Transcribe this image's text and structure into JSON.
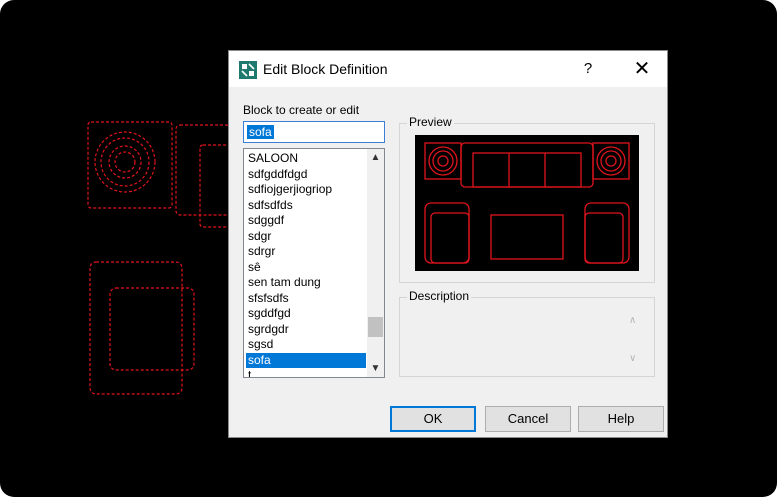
{
  "dialog": {
    "title": "Edit Block Definition",
    "help_glyph": "?",
    "close_glyph": "✕"
  },
  "block": {
    "label": "Block to create or edit",
    "value": "sofa",
    "items": [
      "SALOON",
      "sdfgddfdgd",
      "sdfiojgerjiogriop",
      "sdfsdfds",
      "sdggdf",
      "sdgr",
      "sdrgr",
      "sê",
      "sen tam dung",
      "sfsfsdfs",
      "sgddfgd",
      "sgrdgdr",
      "sgsd",
      "sofa",
      "t"
    ],
    "selected": "sofa"
  },
  "preview": {
    "label": "Preview"
  },
  "description": {
    "label": "Description",
    "value": ""
  },
  "buttons": {
    "ok": "OK",
    "cancel": "Cancel",
    "help": "Help"
  },
  "colors": {
    "accent": "#0078d7",
    "drawing": "#e0141c",
    "canvas": "#000000"
  },
  "icons": {
    "app": "autocad-block-icon",
    "scroll_up": "chevron-up-icon",
    "scroll_down": "chevron-down-icon"
  }
}
